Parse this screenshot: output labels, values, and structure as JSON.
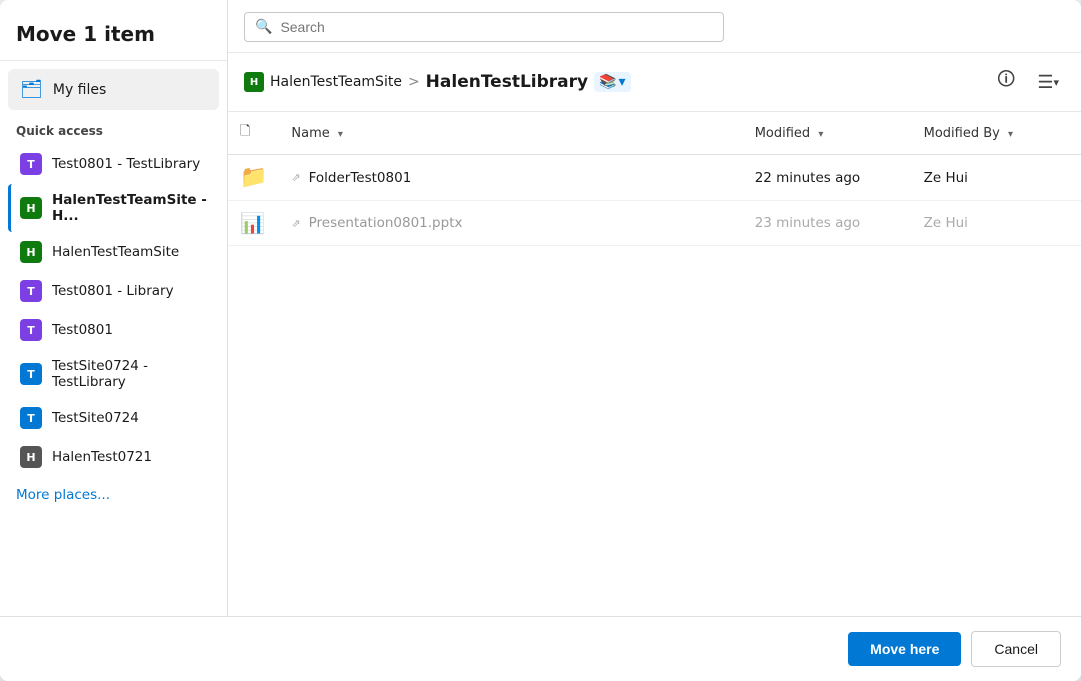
{
  "dialog": {
    "title": "Move 1 item"
  },
  "left": {
    "my_files_label": "My files",
    "quick_access_label": "Quick access",
    "nav_items": [
      {
        "id": "test0801-testlibrary",
        "label": "Test0801 - TestLibrary",
        "color": "#7b3fe4",
        "letter": "T",
        "active": false
      },
      {
        "id": "halentestteamsite-h",
        "label": "HalenTestTeamSite - H...",
        "color": "#0f7b0f",
        "letter": "H",
        "active": true
      },
      {
        "id": "halentestteamsite",
        "label": "HalenTestTeamSite",
        "color": "#0f7b0f",
        "letter": "H",
        "active": false
      },
      {
        "id": "test0801-library",
        "label": "Test0801 - Library",
        "color": "#7b3fe4",
        "letter": "T",
        "active": false
      },
      {
        "id": "test0801",
        "label": "Test0801",
        "color": "#7b3fe4",
        "letter": "T",
        "active": false
      },
      {
        "id": "testsite0724-testlibrary",
        "label": "TestSite0724 - TestLibrary",
        "color": "#0078d4",
        "letter": "T",
        "active": false
      },
      {
        "id": "testsite0724",
        "label": "TestSite0724",
        "color": "#0078d4",
        "letter": "T",
        "active": false
      },
      {
        "id": "halentest0721",
        "label": "HalenTest0721",
        "color": "#555",
        "letter": "H",
        "active": false
      }
    ],
    "more_places": "More places..."
  },
  "right": {
    "search_placeholder": "Search",
    "breadcrumb": {
      "site_label": "HalenTestTeamSite",
      "separator": ">",
      "current_label": "HalenTestLibrary"
    },
    "columns": {
      "name": "Name",
      "modified": "Modified",
      "modified_by": "Modified By"
    },
    "files": [
      {
        "type": "folder",
        "icon": "📁",
        "name": "FolderTest0801",
        "modified": "22 minutes ago",
        "modified_by": "Ze Hui",
        "pinned": true
      },
      {
        "type": "pptx",
        "icon": "📊",
        "name": "Presentation0801.pptx",
        "modified": "23 minutes ago",
        "modified_by": "Ze Hui",
        "pinned": true,
        "greyed": true
      }
    ]
  },
  "footer": {
    "move_label": "Move here",
    "cancel_label": "Cancel"
  }
}
